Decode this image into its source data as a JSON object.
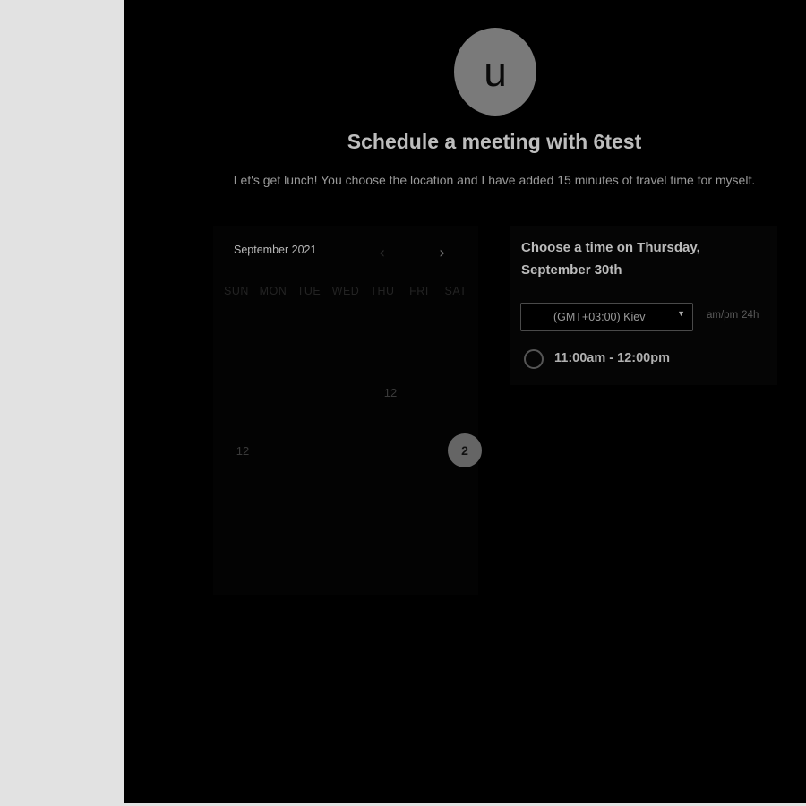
{
  "host": {
    "avatar_letter": "u",
    "title": "Schedule a meeting with 6test",
    "description": "Let's get lunch! You choose the location and I have added 15 minutes of travel time for myself."
  },
  "calendar": {
    "month_label": "September 2021",
    "prev_icon": "chevron-left-icon",
    "next_icon": "chevron-right-icon",
    "weekdays": [
      "SUN",
      "MON",
      "TUE",
      "WED",
      "THU",
      "FRI",
      "SAT"
    ],
    "visible_days": [
      "12",
      "12",
      "2"
    ],
    "selected_day": "2"
  },
  "times": {
    "heading_line1": "Choose a time on Thursday,",
    "heading_line2": "September 30th",
    "timezone": "(GMT+03:00) Kiev",
    "format_ampm": "am/pm",
    "format_24h": "24h",
    "slots": [
      "11:00am - 12:00pm"
    ]
  },
  "colors": {
    "background": "#000000",
    "accent": "#656565",
    "sidebar": "#e2e2e2"
  }
}
